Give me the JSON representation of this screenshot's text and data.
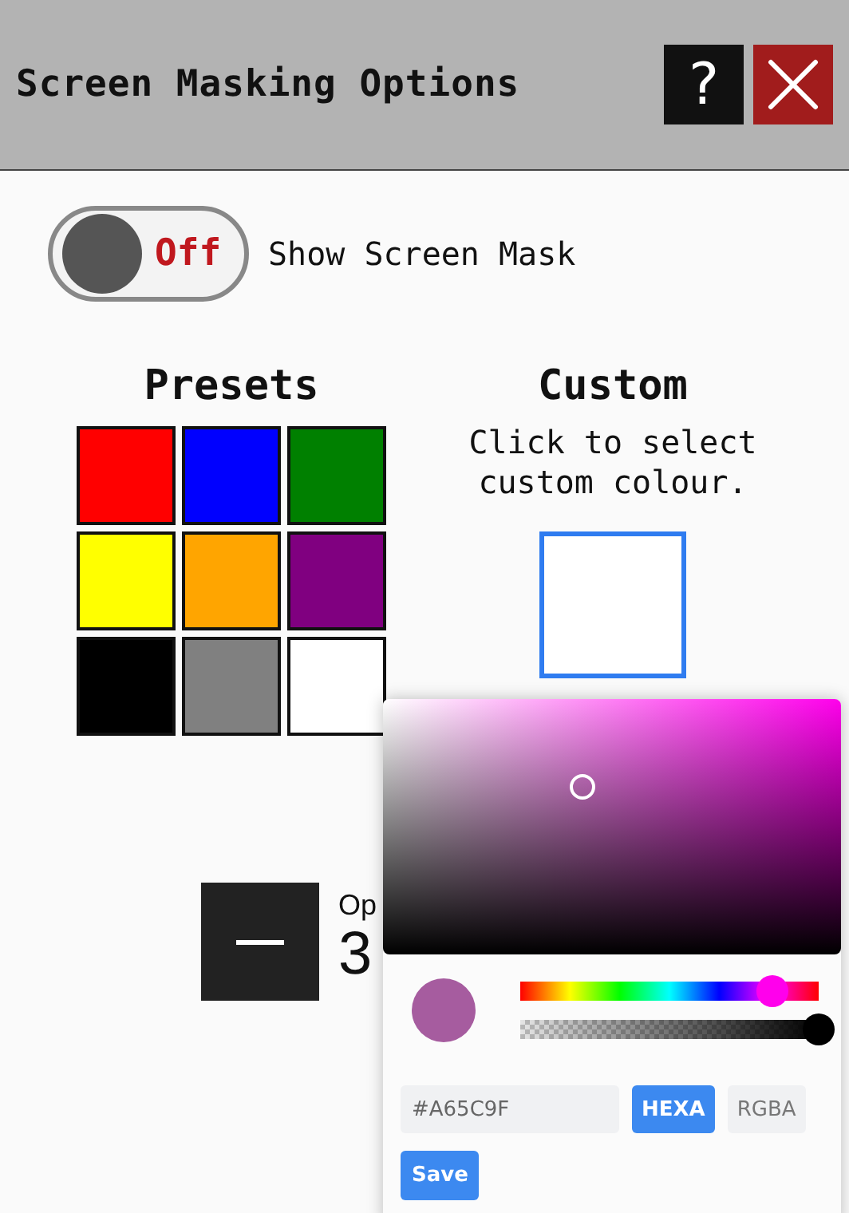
{
  "header": {
    "title": "Screen Masking Options",
    "help_label": "?"
  },
  "mask_toggle": {
    "on": false,
    "state_label": "Off",
    "label": "Show Screen Mask"
  },
  "presets": {
    "heading": "Presets",
    "swatches": [
      {
        "color": "#ff0000"
      },
      {
        "color": "#0000ff"
      },
      {
        "color": "#008000"
      },
      {
        "color": "#ffff00"
      },
      {
        "color": "#ffa500"
      },
      {
        "color": "#800080"
      },
      {
        "color": "#000000"
      },
      {
        "color": "#808080"
      },
      {
        "color": "#ffffff"
      }
    ]
  },
  "custom": {
    "heading": "Custom",
    "hint": "Click to select custom colour.",
    "color": "#ffffff"
  },
  "opacity": {
    "label": "Op",
    "value": "3"
  },
  "color_picker": {
    "hue": {
      "level": 0.846
    },
    "alpha": {
      "level": 1
    },
    "hex_value": "#A65C9F",
    "formats": [
      {
        "label": "HEXA",
        "selected": true
      },
      {
        "label": "RGBA",
        "selected": false
      }
    ],
    "save_label": "Save"
  }
}
